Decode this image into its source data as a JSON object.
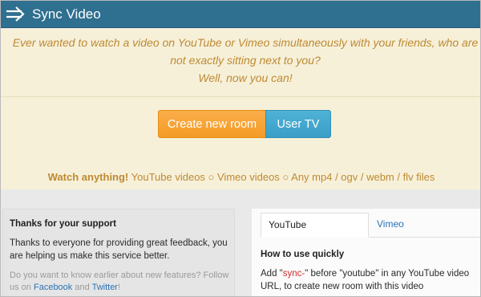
{
  "app": {
    "title": "Sync Video"
  },
  "hero": {
    "tagline_line1": "Ever wanted to watch a video on YouTube or Vimeo simultaneously with your friends, who are",
    "tagline_line2": "not exactly sitting next to you?",
    "tagline_line3": "Well, now you can!",
    "create_room_label": "Create new room",
    "user_tv_label": "User TV",
    "watch_bold": "Watch anything!",
    "watch_rest": " YouTube videos ○ Vimeo videos ○ Any mp4 / ogv / webm / flv files"
  },
  "support": {
    "heading": "Thanks for your support",
    "body": "Thanks to everyone for providing great feedback, you are helping us make this service better.",
    "muted_line": "Do you want to know earlier about new features? Follow us on",
    "facebook_link": "Facebook",
    "and_text": "and",
    "twitter_link": "Twitter",
    "bang": "!"
  },
  "howto": {
    "tab_youtube": "YouTube",
    "tab_vimeo": "Vimeo",
    "heading": "How to use quickly",
    "text_part1": "Add \"",
    "text_highlight": "sync-",
    "text_part2": "\" before \"youtube\" in any YouTube video URL, to create new room with this video"
  }
}
